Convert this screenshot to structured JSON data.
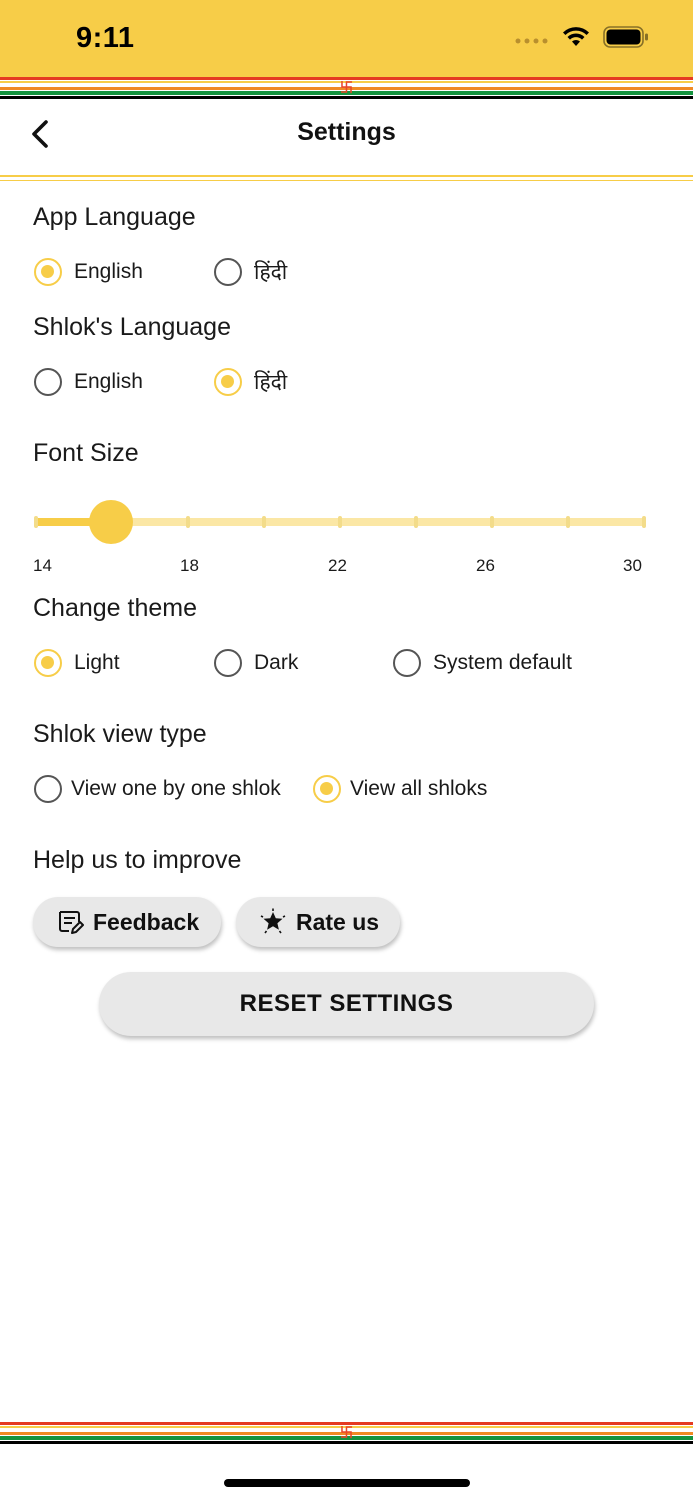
{
  "status_bar": {
    "time": "9:11"
  },
  "decoration": {
    "emblem_glyph": "卐"
  },
  "header": {
    "title": "Settings",
    "back_icon": "chevron-left-icon"
  },
  "app_language": {
    "title": "App Language",
    "options": [
      {
        "label": "English",
        "selected": true
      },
      {
        "label": "हिंदी",
        "selected": false
      }
    ]
  },
  "shlok_language": {
    "title": "Shlok's Language",
    "options": [
      {
        "label": "English",
        "selected": false
      },
      {
        "label": "हिंदी",
        "selected": true
      }
    ]
  },
  "font_size": {
    "title": "Font Size",
    "min": 14,
    "max": 30,
    "value": 16,
    "labels": [
      "14",
      "18",
      "22",
      "26",
      "30"
    ]
  },
  "theme": {
    "title": "Change theme",
    "options": [
      {
        "label": "Light",
        "selected": true
      },
      {
        "label": "Dark",
        "selected": false
      },
      {
        "label": "System default",
        "selected": false
      }
    ]
  },
  "shlok_view": {
    "title": "Shlok view type",
    "options": [
      {
        "label": "View one by one shlok",
        "selected": false
      },
      {
        "label": "View all shloks",
        "selected": true
      }
    ]
  },
  "help": {
    "title": "Help us to improve",
    "feedback_label": "Feedback",
    "feedback_icon": "feedback-icon",
    "rate_label": "Rate us",
    "rate_icon": "star-badge-icon"
  },
  "reset_label": "RESET SETTINGS",
  "colors": {
    "accent": "#f7cd48",
    "accent_light": "#fbe7a5",
    "stripe_saffron": "#f08a24",
    "stripe_red": "#e53a22",
    "stripe_green": "#14933f"
  }
}
